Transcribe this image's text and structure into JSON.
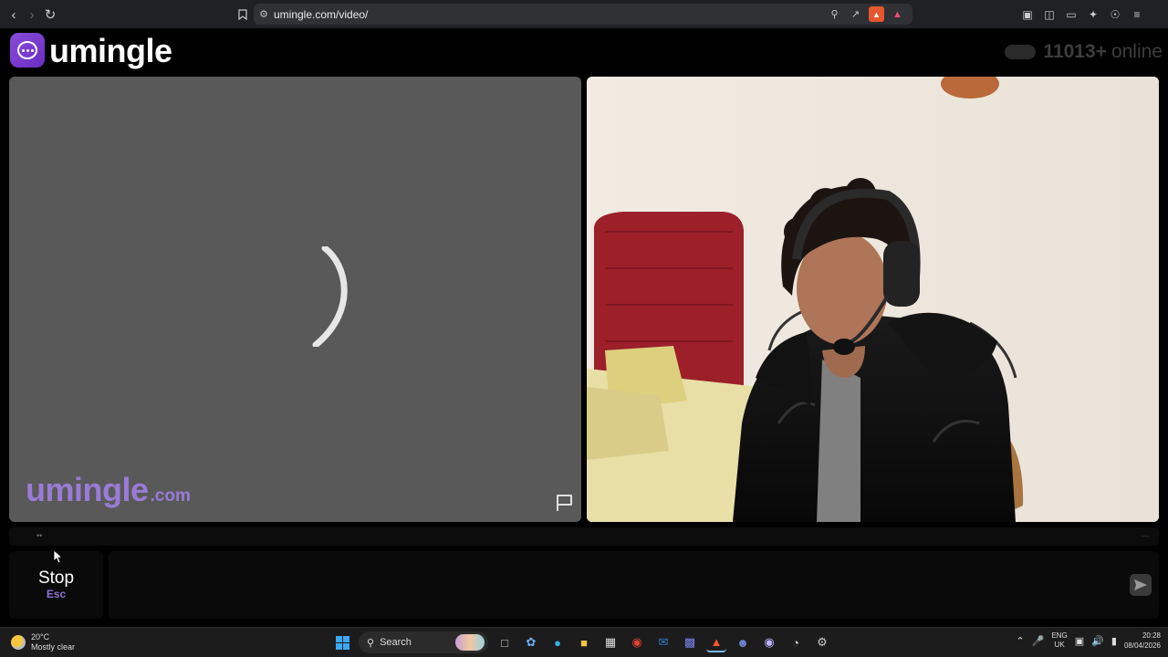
{
  "browser": {
    "url": "umingle.com/video/",
    "icons": {
      "back": "back-arrow-icon",
      "forward": "forward-arrow-icon",
      "reload": "reload-icon",
      "bookmark": "bookmark-icon",
      "site_info": "site-info-icon",
      "zoom": "zoom-icon",
      "share": "share-icon",
      "brave_shields": "brave-shields-icon",
      "brave_rewards": "brave-rewards-icon"
    }
  },
  "header": {
    "logo_text": "umingle",
    "online_count": "11013+",
    "online_label": "online"
  },
  "video": {
    "watermark_main": "umingle",
    "watermark_tld": ".com",
    "report_icon": "flag-icon",
    "loading_icon": "spinner-icon"
  },
  "controls": {
    "stop_label": "Stop",
    "stop_key": "Esc",
    "send_icon": "send-icon"
  },
  "taskbar": {
    "temperature": "20°C",
    "weather_desc": "Mostly clear",
    "search_label": "Search",
    "lang_line1": "ENG",
    "lang_line2": "UK",
    "time": "20:28",
    "date": "08/04/2026"
  },
  "colors": {
    "brand_purple": "#7c3fd4",
    "watermark_purple": "#9a7bd6",
    "stop_key_purple": "#8f73d6",
    "loading_panel": "#595959"
  }
}
